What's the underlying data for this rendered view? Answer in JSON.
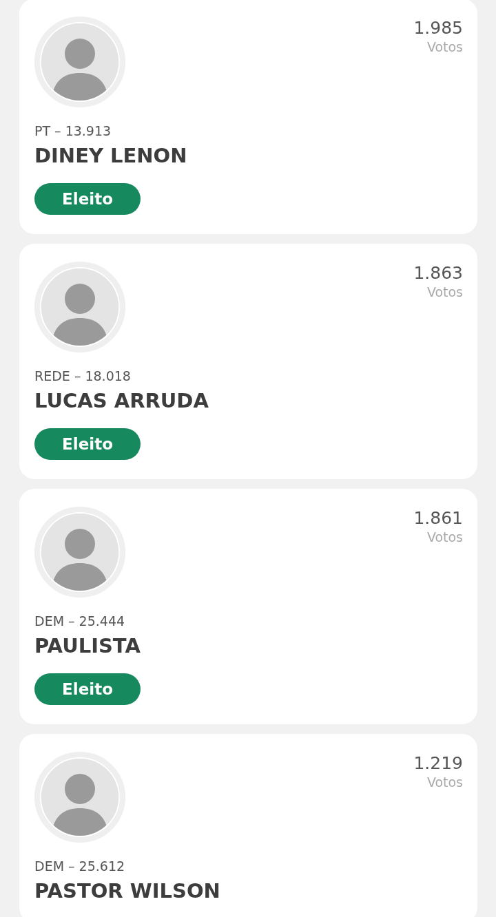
{
  "candidates": [
    {
      "party_number": "PT – 13.913",
      "name": "DINEY LENON",
      "votes": "1.985",
      "votes_label": "Votos",
      "status": "Eleito"
    },
    {
      "party_number": "REDE – 18.018",
      "name": "LUCAS ARRUDA",
      "votes": "1.863",
      "votes_label": "Votos",
      "status": "Eleito"
    },
    {
      "party_number": "DEM – 25.444",
      "name": "PAULISTA",
      "votes": "1.861",
      "votes_label": "Votos",
      "status": "Eleito"
    },
    {
      "party_number": "DEM – 25.612",
      "name": "PASTOR WILSON",
      "votes": "1.219",
      "votes_label": "Votos"
    }
  ]
}
